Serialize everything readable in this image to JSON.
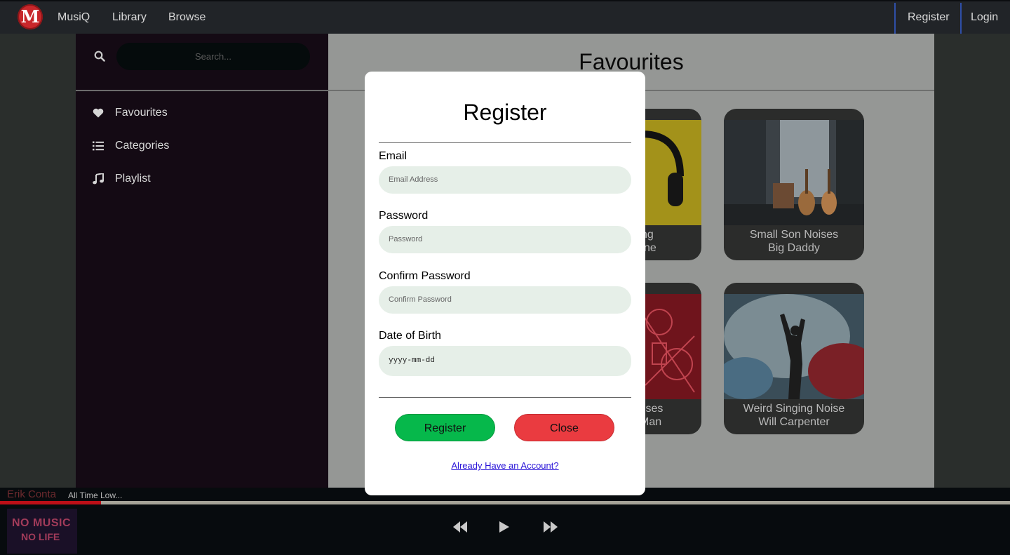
{
  "topnav": {
    "logo_letter": "M",
    "brand": "MusiQ",
    "links": [
      "Library",
      "Browse"
    ],
    "register": "Register",
    "login": "Login"
  },
  "sidebar": {
    "search_placeholder": "Search...",
    "items": [
      {
        "label": "Favourites",
        "icon": "heart-icon"
      },
      {
        "label": "Categories",
        "icon": "list-icon"
      },
      {
        "label": "Playlist",
        "icon": "music-note-icon"
      }
    ]
  },
  "main": {
    "title": "Favourites",
    "cards": [
      {
        "title_partial": "ng",
        "artist_partial": "yne"
      },
      {
        "title": "Small Son Noises",
        "artist": "Big Daddy"
      },
      {
        "title_partial": "oises",
        "artist_partial": "Man"
      },
      {
        "title": "Weird Singing Noise",
        "artist": "Will Carpenter"
      }
    ]
  },
  "player": {
    "artist": "Erik Conta",
    "song": "All Time Low...",
    "progress": 0.1,
    "album_line1": "NO MUSIC",
    "album_line2": "NO LIFE"
  },
  "modal": {
    "title": "Register",
    "fields": [
      {
        "label": "Email",
        "placeholder": "Email Address"
      },
      {
        "label": "Password",
        "placeholder": "Password"
      },
      {
        "label": "Confirm Password",
        "placeholder": "Confirm Password"
      },
      {
        "label": "Date of Birth",
        "placeholder": "yyyy-mm-dd"
      }
    ],
    "register_button": "Register",
    "close_button": "Close",
    "already_link": "Already Have an Account?"
  },
  "colors": {
    "register_green": "#06b84b",
    "close_red": "#ea3b40",
    "input_bg": "#e6efe8",
    "sidebar_bg": "#140a14",
    "progress_red": "#bd0f17"
  }
}
